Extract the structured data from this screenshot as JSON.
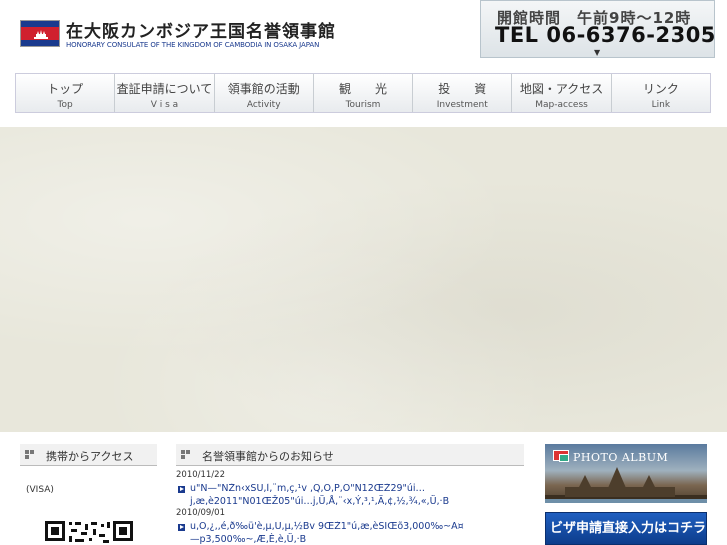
{
  "header": {
    "title": "在大阪カンボジア王国名誉領事館",
    "subtitle": "HONORARY CONSULATE OF THE KINGDOM OF CAMBODIA IN OSAKA JAPAN",
    "hours": "開館時間　午前9時～12時",
    "tel": "TEL 06-6376-2305",
    "hours_arrow": "▼"
  },
  "nav": {
    "items": [
      {
        "jp": "トップ",
        "en": "Top"
      },
      {
        "jp": "査証申請について",
        "en": "V i s a"
      },
      {
        "jp": "領事館の活動",
        "en": "Activity"
      },
      {
        "jp": "観　　光",
        "en": "Tourism"
      },
      {
        "jp": "投　　資",
        "en": "Investment"
      },
      {
        "jp": "地図・アクセス",
        "en": "Map-access"
      },
      {
        "jp": "リンク",
        "en": "Link"
      }
    ]
  },
  "mobile": {
    "heading": "携帯からアクセス",
    "visa_label": "(VISA)"
  },
  "news": {
    "heading": "名誉領事館からのお知らせ",
    "entries": [
      {
        "date": "2010/11/22",
        "lines": [
          "u\"N—\"NŽn‹xŠÚ‚Ì‚¨m‚ç‚¹v ,Q,O,P,O\"N12ŒŽ29\"úi…",
          "j‚æ‚è2011\"N01ŒŽ05\"úi…j‚Ü‚Å‚¨‹x‚Ý‚³‚¹‚Ä‚¢‚½‚¾‚«‚Ü‚·B"
        ]
      },
      {
        "date": "2010/09/01",
        "lines": [
          "u‚Ó‚¿‚‚é‚ð‰ü'è‚µ‚Ü‚µ‚½Bv 9ŒŽ1\"ú‚æ‚èŠÏŒõ3,000‰~A¤",
          "—p3,500‰~‚Æ‚È‚è‚Ü‚·B"
        ]
      }
    ]
  },
  "sidebar": {
    "photo_album": "PHOTO ALBUM",
    "visa_banner": "ビザ申請直接入力はコチラ"
  },
  "colors": {
    "accent_blue": "#1a3a8e",
    "flag_red": "#d0202e",
    "hero_bg": "#e8e7db"
  }
}
